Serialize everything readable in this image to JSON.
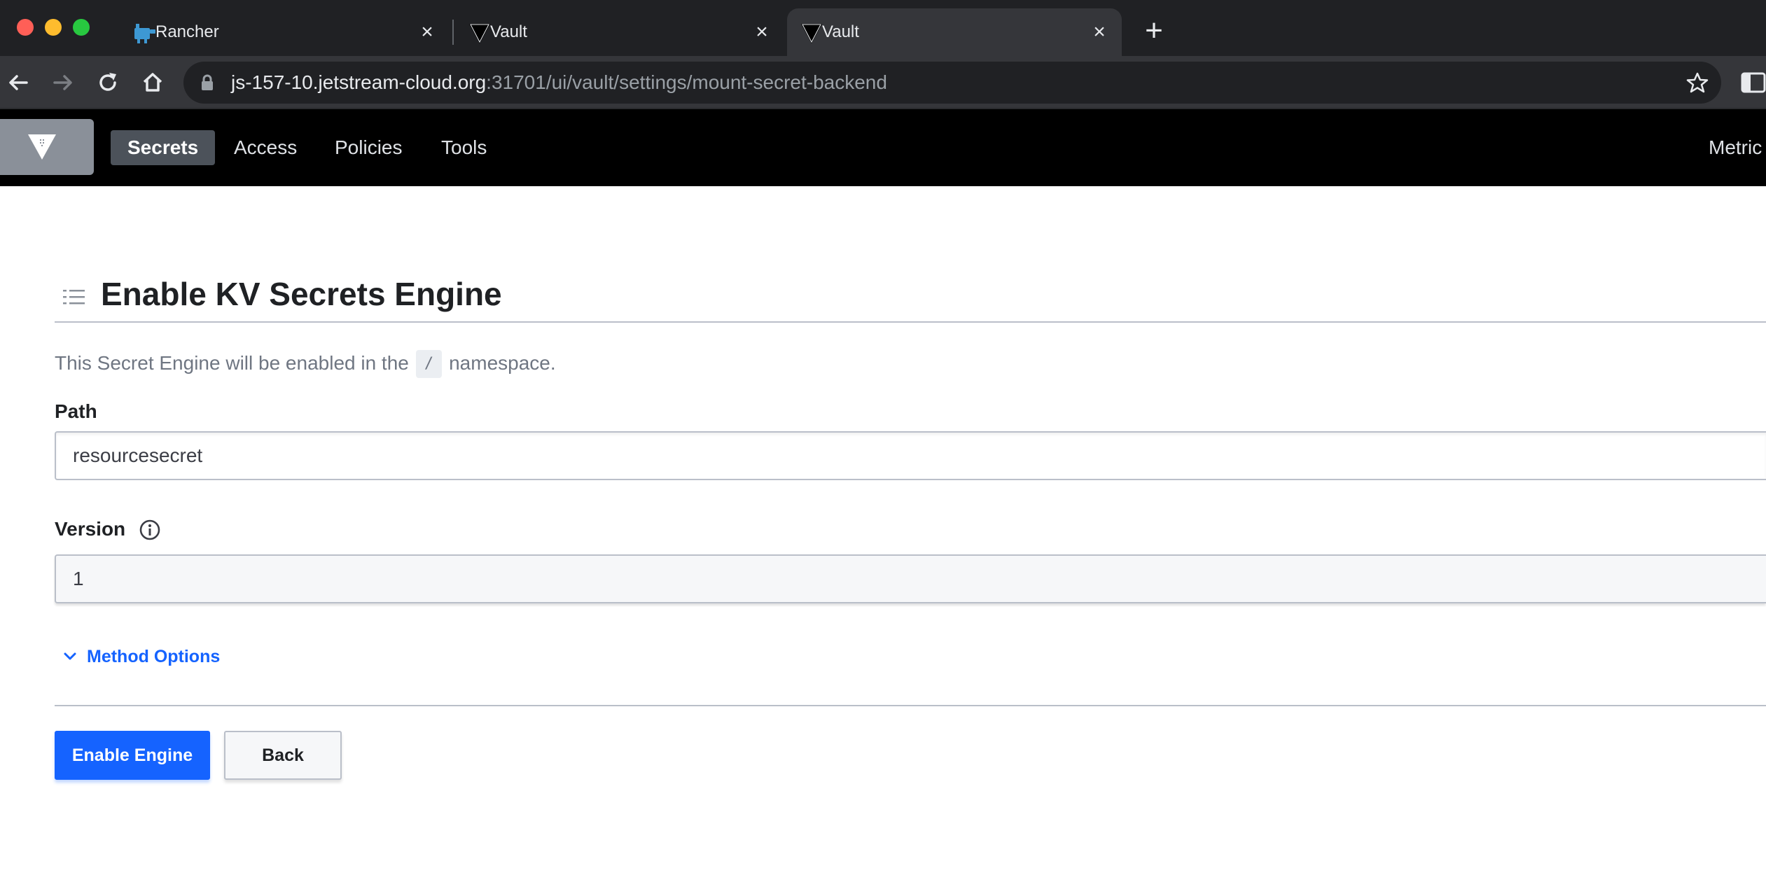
{
  "browser": {
    "tabs": [
      {
        "title": "Rancher",
        "favicon": "rancher-logo-icon",
        "active": false
      },
      {
        "title": "Vault",
        "favicon": "vault-logo-icon",
        "active": false
      },
      {
        "title": "Vault",
        "favicon": "vault-logo-icon",
        "active": true
      }
    ],
    "url_host": "js-157-10.jetstream-cloud.org",
    "url_rest": ":31701/ui/vault/settings/mount-secret-backend"
  },
  "vault_nav": {
    "items": [
      "Secrets",
      "Access",
      "Policies",
      "Tools"
    ],
    "active_item": "Secrets",
    "right_item": "Metric"
  },
  "page": {
    "title": "Enable KV Secrets Engine",
    "namespace_text_before": "This Secret Engine will be enabled in the",
    "namespace_value": "/",
    "namespace_text_after": "namespace.",
    "path_label": "Path",
    "path_value": "resourcesecret",
    "version_label": "Version",
    "version_value": "1",
    "method_options_label": "Method Options",
    "enable_button": "Enable Engine",
    "back_button": "Back"
  },
  "colors": {
    "primary_blue": "#1563ff",
    "nav_bg": "#000000",
    "browser_bg": "#202124"
  }
}
